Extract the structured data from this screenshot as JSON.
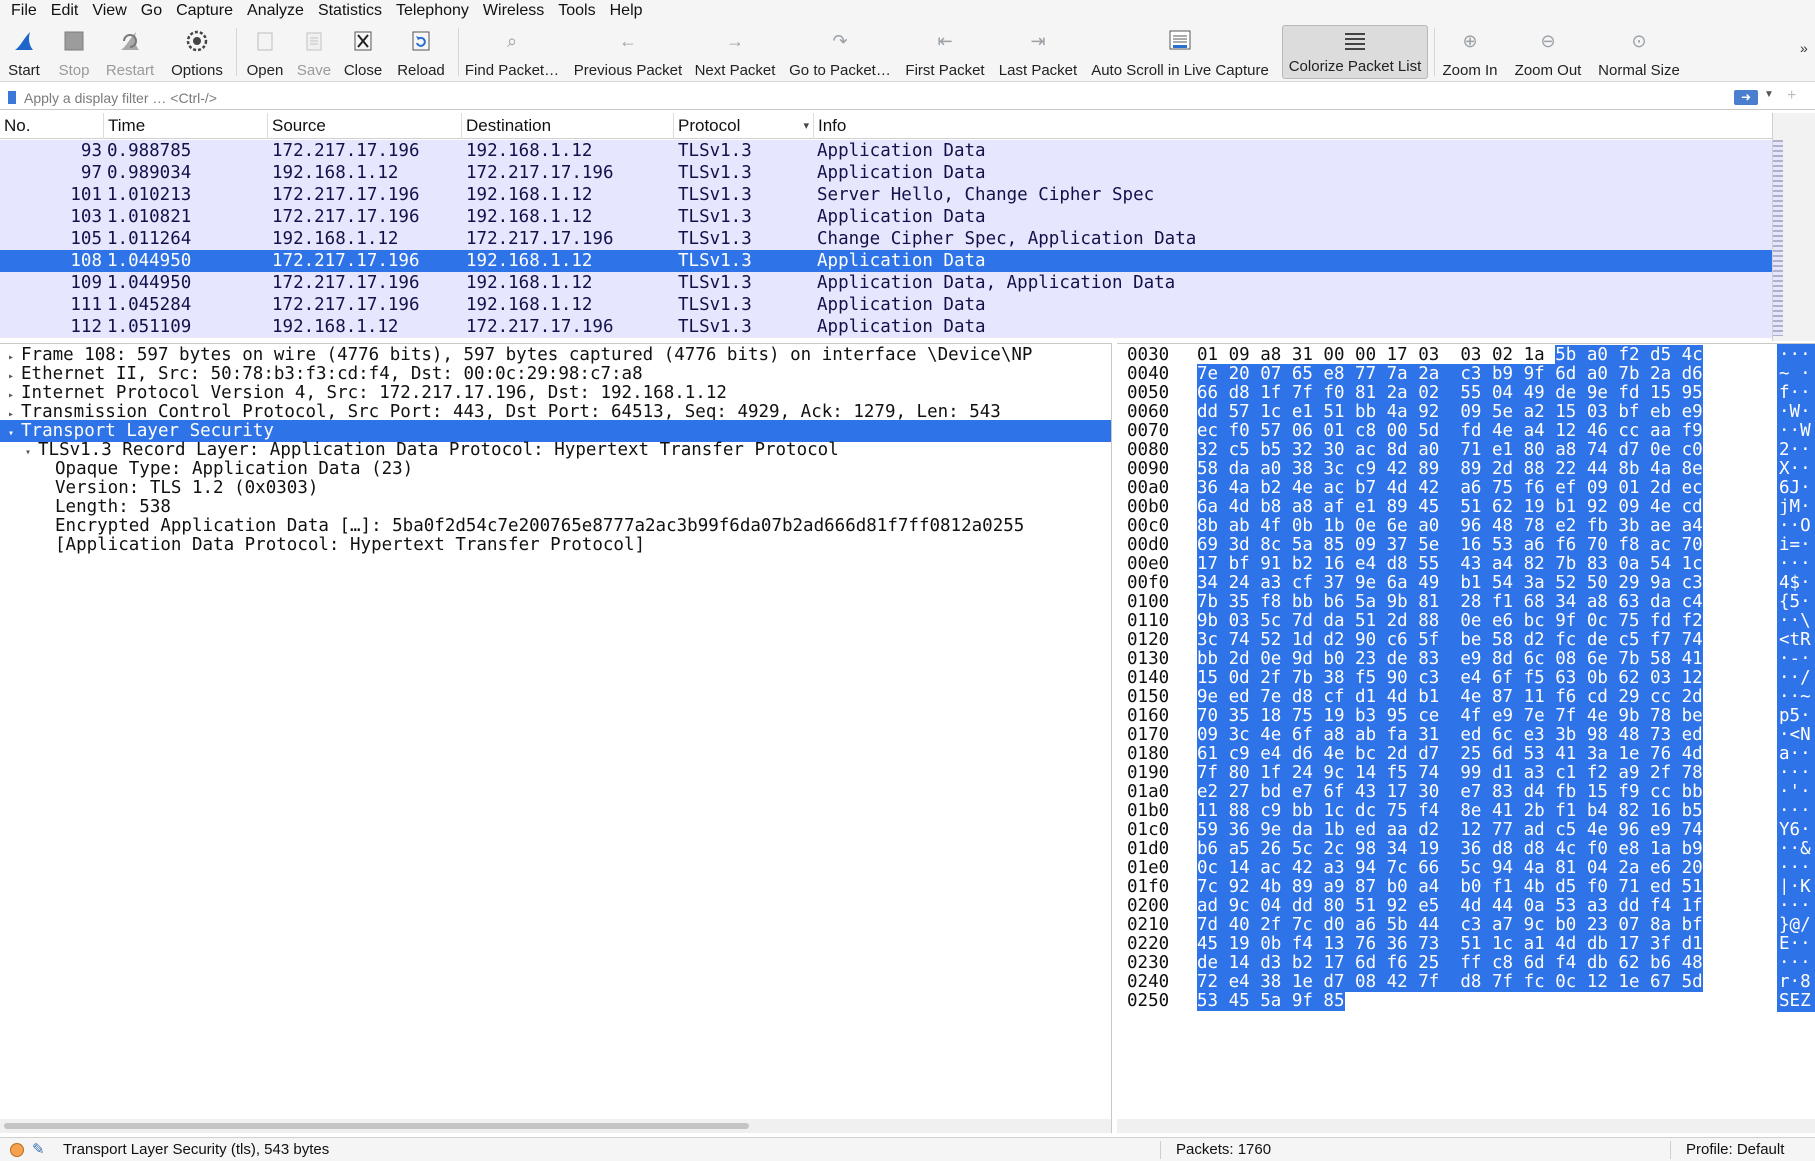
{
  "menubar": {
    "items": [
      "File",
      "Edit",
      "View",
      "Go",
      "Capture",
      "Analyze",
      "Statistics",
      "Telephony",
      "Wireless",
      "Tools",
      "Help"
    ]
  },
  "toolbar": {
    "start": "Start",
    "stop": "Stop",
    "restart": "Restart",
    "options": "Options",
    "open": "Open",
    "save": "Save",
    "close": "Close",
    "reload": "Reload",
    "find_packet": "Find Packet…",
    "previous_packet": "Previous Packet",
    "next_packet": "Next Packet",
    "go_to_packet": "Go to Packet…",
    "first_packet": "First Packet",
    "last_packet": "Last Packet",
    "auto_scroll": "Auto Scroll in Live Capture",
    "colorize": "Colorize Packet List",
    "zoom_in": "Zoom In",
    "zoom_out": "Zoom Out",
    "normal_size": "Normal Size",
    "overflow": "»",
    "icons": {
      "start": "shark-fin-icon",
      "stop": "stop-square-icon",
      "restart": "restart-fin-icon",
      "options": "gear-icon",
      "open": "folder-open-icon",
      "save": "save-icon",
      "close": "close-file-icon",
      "reload": "reload-icon"
    }
  },
  "filter": {
    "placeholder": "Apply a display filter … <Ctrl-/>",
    "apply_icon": "arrow-right-icon",
    "dropdown_icon": "chevron-down-icon",
    "add_icon": "plus-icon"
  },
  "packet_list": {
    "columns": [
      "No.",
      "Time",
      "Source",
      "Destination",
      "Protocol",
      "Info"
    ],
    "sort_indicator": "▾",
    "rows": [
      {
        "no": "93",
        "time": "0.988785",
        "src": "172.217.17.196",
        "dst": "192.168.1.12",
        "proto": "TLSv1.3",
        "info": "Application Data"
      },
      {
        "no": "97",
        "time": "0.989034",
        "src": "192.168.1.12",
        "dst": "172.217.17.196",
        "proto": "TLSv1.3",
        "info": "Application Data"
      },
      {
        "no": "101",
        "time": "1.010213",
        "src": "172.217.17.196",
        "dst": "192.168.1.12",
        "proto": "TLSv1.3",
        "info": "Server Hello, Change Cipher Spec"
      },
      {
        "no": "103",
        "time": "1.010821",
        "src": "172.217.17.196",
        "dst": "192.168.1.12",
        "proto": "TLSv1.3",
        "info": "Application Data"
      },
      {
        "no": "105",
        "time": "1.011264",
        "src": "192.168.1.12",
        "dst": "172.217.17.196",
        "proto": "TLSv1.3",
        "info": "Change Cipher Spec, Application Data"
      },
      {
        "no": "108",
        "time": "1.044950",
        "src": "172.217.17.196",
        "dst": "192.168.1.12",
        "proto": "TLSv1.3",
        "info": "Application Data",
        "selected": true
      },
      {
        "no": "109",
        "time": "1.044950",
        "src": "172.217.17.196",
        "dst": "192.168.1.12",
        "proto": "TLSv1.3",
        "info": "Application Data, Application Data"
      },
      {
        "no": "111",
        "time": "1.045284",
        "src": "172.217.17.196",
        "dst": "192.168.1.12",
        "proto": "TLSv1.3",
        "info": "Application Data"
      },
      {
        "no": "112",
        "time": "1.051109",
        "src": "192.168.1.12",
        "dst": "172.217.17.196",
        "proto": "TLSv1.3",
        "info": "Application Data"
      }
    ]
  },
  "details": {
    "rows": [
      {
        "indent": 0,
        "toggle": "▸",
        "text": "Frame 108: 597 bytes on wire (4776 bits), 597 bytes captured (4776 bits) on interface \\Device\\NP"
      },
      {
        "indent": 0,
        "toggle": "▸",
        "text": "Ethernet II, Src: 50:78:b3:f3:cd:f4, Dst: 00:0c:29:98:c7:a8"
      },
      {
        "indent": 0,
        "toggle": "▸",
        "text": "Internet Protocol Version 4, Src: 172.217.17.196, Dst: 192.168.1.12"
      },
      {
        "indent": 0,
        "toggle": "▸",
        "text": "Transmission Control Protocol, Src Port: 443, Dst Port: 64513, Seq: 4929, Ack: 1279, Len: 543"
      },
      {
        "indent": 0,
        "toggle": "▾",
        "text": "Transport Layer Security",
        "selected": true
      },
      {
        "indent": 1,
        "toggle": "▾",
        "text": "TLSv1.3 Record Layer: Application Data Protocol: Hypertext Transfer Protocol"
      },
      {
        "indent": 2,
        "toggle": "",
        "text": "Opaque Type: Application Data (23)"
      },
      {
        "indent": 2,
        "toggle": "",
        "text": "Version: TLS 1.2 (0x0303)"
      },
      {
        "indent": 2,
        "toggle": "",
        "text": "Length: 538"
      },
      {
        "indent": 2,
        "toggle": "",
        "text": "Encrypted Application Data […]: 5ba0f2d54c7e200765e8777a2ac3b99f6da07b2ad666d81f7ff0812a0255"
      },
      {
        "indent": 2,
        "toggle": "",
        "text": "[Application Data Protocol: Hypertext Transfer Protocol]"
      }
    ]
  },
  "bytes": {
    "rows": [
      {
        "offset": "0030",
        "hex": "01 09 a8 31 00 00 17 03  03 02 1a 5b a0 f2 d5 4c",
        "hl_start": 11,
        "ascii": "···"
      },
      {
        "offset": "0040",
        "hex": "7e 20 07 65 e8 77 7a 2a  c3 b9 9f 6d a0 7b 2a d6",
        "hl_start": 0,
        "ascii": "~ ·"
      },
      {
        "offset": "0050",
        "hex": "66 d8 1f 7f f0 81 2a 02  55 04 49 de 9e fd 15 95",
        "hl_start": 0,
        "ascii": "f··"
      },
      {
        "offset": "0060",
        "hex": "dd 57 1c e1 51 bb 4a 92  09 5e a2 15 03 bf eb e9",
        "hl_start": 0,
        "ascii": "·W·"
      },
      {
        "offset": "0070",
        "hex": "ec f0 57 06 01 c8 00 5d  fd 4e a4 12 46 cc aa f9",
        "hl_start": 0,
        "ascii": "··W"
      },
      {
        "offset": "0080",
        "hex": "32 c5 b5 32 30 ac 8d a0  71 e1 80 a8 74 d7 0e c0",
        "hl_start": 0,
        "ascii": "2··"
      },
      {
        "offset": "0090",
        "hex": "58 da a0 38 3c c9 42 89  89 2d 88 22 44 8b 4a 8e",
        "hl_start": 0,
        "ascii": "X··"
      },
      {
        "offset": "00a0",
        "hex": "36 4a b2 4e ac b7 4d 42  a6 75 f6 ef 09 01 2d ec",
        "hl_start": 0,
        "ascii": "6J·"
      },
      {
        "offset": "00b0",
        "hex": "6a 4d b8 a8 af e1 89 45  51 62 19 b1 92 09 4e cd",
        "hl_start": 0,
        "ascii": "jM·"
      },
      {
        "offset": "00c0",
        "hex": "8b ab 4f 0b 1b 0e 6e a0  96 48 78 e2 fb 3b ae a4",
        "hl_start": 0,
        "ascii": "··O"
      },
      {
        "offset": "00d0",
        "hex": "69 3d 8c 5a 85 09 37 5e  16 53 a6 f6 70 f8 ac 70",
        "hl_start": 0,
        "ascii": "i=·"
      },
      {
        "offset": "00e0",
        "hex": "17 bf 91 b2 16 e4 d8 55  43 a4 82 7b 83 0a 54 1c",
        "hl_start": 0,
        "ascii": "···"
      },
      {
        "offset": "00f0",
        "hex": "34 24 a3 cf 37 9e 6a 49  b1 54 3a 52 50 29 9a c3",
        "hl_start": 0,
        "ascii": "4$·"
      },
      {
        "offset": "0100",
        "hex": "7b 35 f8 bb b6 5a 9b 81  28 f1 68 34 a8 63 da c4",
        "hl_start": 0,
        "ascii": "{5·"
      },
      {
        "offset": "0110",
        "hex": "9b 03 5c 7d da 51 2d 88  0e e6 bc 9f 0c 75 fd f2",
        "hl_start": 0,
        "ascii": "··\\"
      },
      {
        "offset": "0120",
        "hex": "3c 74 52 1d d2 90 c6 5f  be 58 d2 fc de c5 f7 74",
        "hl_start": 0,
        "ascii": "<tR"
      },
      {
        "offset": "0130",
        "hex": "bb 2d 0e 9d b0 23 de 83  e9 8d 6c 08 6e 7b 58 41",
        "hl_start": 0,
        "ascii": "·-·"
      },
      {
        "offset": "0140",
        "hex": "15 0d 2f 7b 38 f5 90 c3  e4 6f f5 63 0b 62 03 12",
        "hl_start": 0,
        "ascii": "··/"
      },
      {
        "offset": "0150",
        "hex": "9e ed 7e d8 cf d1 4d b1  4e 87 11 f6 cd 29 cc 2d",
        "hl_start": 0,
        "ascii": "··~"
      },
      {
        "offset": "0160",
        "hex": "70 35 18 75 19 b3 95 ce  4f e9 7e 7f 4e 9b 78 be",
        "hl_start": 0,
        "ascii": "p5·"
      },
      {
        "offset": "0170",
        "hex": "09 3c 4e 6f a8 ab fa 31  ed 6c e3 3b 98 48 73 ed",
        "hl_start": 0,
        "ascii": "·<N"
      },
      {
        "offset": "0180",
        "hex": "61 c9 e4 d6 4e bc 2d d7  25 6d 53 41 3a 1e 76 4d",
        "hl_start": 0,
        "ascii": "a··"
      },
      {
        "offset": "0190",
        "hex": "7f 80 1f 24 9c 14 f5 74  99 d1 a3 c1 f2 a9 2f 78",
        "hl_start": 0,
        "ascii": "···"
      },
      {
        "offset": "01a0",
        "hex": "e2 27 bd e7 6f 43 17 30  e7 83 d4 fb 15 f9 cc bb",
        "hl_start": 0,
        "ascii": "·'·"
      },
      {
        "offset": "01b0",
        "hex": "11 88 c9 bb 1c dc 75 f4  8e 41 2b f1 b4 82 16 b5",
        "hl_start": 0,
        "ascii": "···"
      },
      {
        "offset": "01c0",
        "hex": "59 36 9e da 1b ed aa d2  12 77 ad c5 4e 96 e9 74",
        "hl_start": 0,
        "ascii": "Y6·"
      },
      {
        "offset": "01d0",
        "hex": "b6 a5 26 5c 2c 98 34 19  36 d8 d8 4c f0 e8 1a b9",
        "hl_start": 0,
        "ascii": "··&"
      },
      {
        "offset": "01e0",
        "hex": "0c 14 ac 42 a3 94 7c 66  5c 94 4a 81 04 2a e6 20",
        "hl_start": 0,
        "ascii": "···"
      },
      {
        "offset": "01f0",
        "hex": "7c 92 4b 89 a9 87 b0 a4  b0 f1 4b d5 f0 71 ed 51",
        "hl_start": 0,
        "ascii": "|·K"
      },
      {
        "offset": "0200",
        "hex": "ad 9c 04 dd 80 51 92 e5  4d 44 0a 53 a3 dd f4 1f",
        "hl_start": 0,
        "ascii": "···"
      },
      {
        "offset": "0210",
        "hex": "7d 40 2f 7c d0 a6 5b 44  c3 a7 9c b0 23 07 8a bf",
        "hl_start": 0,
        "ascii": "}@/"
      },
      {
        "offset": "0220",
        "hex": "45 19 0b f4 13 76 36 73  51 1c a1 4d db 17 3f d1",
        "hl_start": 0,
        "ascii": "E··"
      },
      {
        "offset": "0230",
        "hex": "de 14 d3 b2 17 6d f6 25  ff c8 6d f4 db 62 b6 48",
        "hl_start": 0,
        "ascii": "···"
      },
      {
        "offset": "0240",
        "hex": "72 e4 38 1e d7 08 42 7f  d8 7f fc 0c 12 1e 67 5d",
        "hl_start": 0,
        "ascii": "r·8"
      },
      {
        "offset": "0250",
        "hex": "53 45 5a 9f 85",
        "hl_start": 0,
        "ascii": "SEZ"
      }
    ]
  },
  "status": {
    "text": "Transport Layer Security (tls), 543 bytes",
    "packets": "Packets: 1760",
    "profile": "Profile: Default",
    "expert_icon": "expert-info-icon",
    "comment_icon": "edit-comment-icon"
  },
  "colors": {
    "selection": "#2f73e8",
    "row_bg": "#e7e6ff",
    "row_text": "#12124a"
  }
}
